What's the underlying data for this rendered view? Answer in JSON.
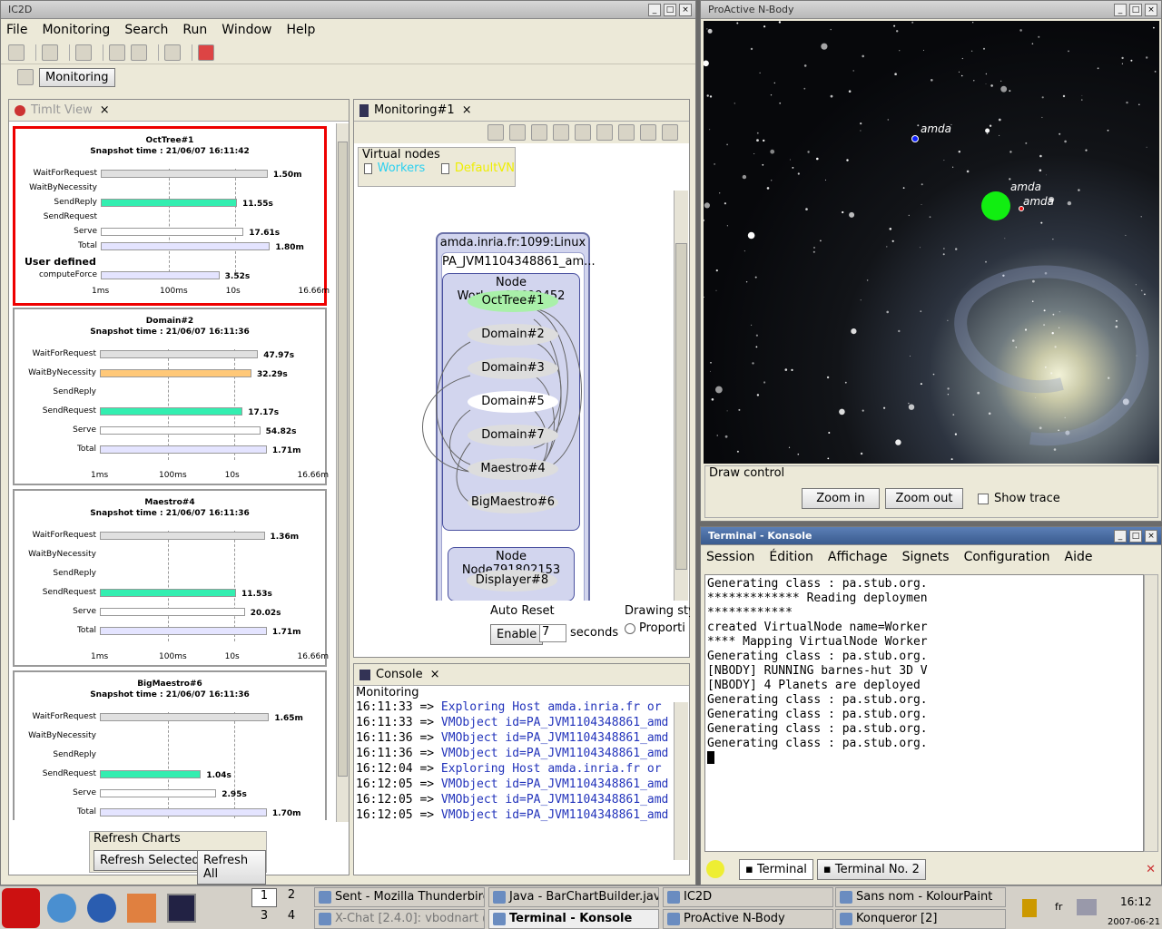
{
  "ic2d": {
    "title": "IC2D",
    "menu": [
      "File",
      "Monitoring",
      "Search",
      "Run",
      "Window",
      "Help"
    ],
    "perspective": "Monitoring",
    "timit": {
      "tab": "TimIt View",
      "axis": [
        "1ms",
        "100ms",
        "10s",
        "16.66m"
      ],
      "charts": [
        {
          "title": "OctTree#1",
          "snapshot": "Snapshot time : 21/06/07 16:11:42",
          "rows": [
            [
              "WaitForRequest",
              "1.50m",
              0.76,
              "#e0e0e0"
            ],
            [
              "WaitByNecessity",
              "",
              0,
              "#fff"
            ],
            [
              "SendReply",
              "11.55s",
              0.62,
              "#33eeb0"
            ],
            [
              "SendRequest",
              "",
              0,
              "#fff"
            ],
            [
              "Serve",
              "17.61s",
              0.65,
              "#fff"
            ],
            [
              "Total",
              "1.80m",
              0.77,
              "#e4e4ff"
            ]
          ],
          "user_defined": "User defined",
          "extra": [
            "computeForce",
            "3.52s",
            0.54
          ]
        },
        {
          "title": "Domain#2",
          "snapshot": "Snapshot time : 21/06/07 16:11:36",
          "rows": [
            [
              "WaitForRequest",
              "47.97s",
              0.72,
              "#e0e0e0"
            ],
            [
              "WaitByNecessity",
              "32.29s",
              0.69,
              "#ffc878"
            ],
            [
              "SendReply",
              "",
              0,
              "#fff"
            ],
            [
              "SendRequest",
              "17.17s",
              0.65,
              "#33eeb0"
            ],
            [
              "Serve",
              "54.82s",
              0.73,
              "#fff"
            ],
            [
              "Total",
              "1.71m",
              0.76,
              "#e4e4ff"
            ]
          ]
        },
        {
          "title": "Maestro#4",
          "snapshot": "Snapshot time : 21/06/07 16:11:36",
          "rows": [
            [
              "WaitForRequest",
              "1.36m",
              0.75,
              "#e0e0e0"
            ],
            [
              "WaitByNecessity",
              "",
              0,
              "#fff"
            ],
            [
              "SendReply",
              "",
              0,
              "#fff"
            ],
            [
              "SendRequest",
              "11.53s",
              0.62,
              "#33eeb0"
            ],
            [
              "Serve",
              "20.02s",
              0.66,
              "#fff"
            ],
            [
              "Total",
              "1.71m",
              0.76,
              "#e4e4ff"
            ]
          ]
        },
        {
          "title": "BigMaestro#6",
          "snapshot": "Snapshot time : 21/06/07 16:11:36",
          "rows": [
            [
              "WaitForRequest",
              "1.65m",
              0.77,
              "#e0e0e0"
            ],
            [
              "WaitByNecessity",
              "",
              0,
              "#fff"
            ],
            [
              "SendReply",
              "",
              0,
              "#fff"
            ],
            [
              "SendRequest",
              "1.04s",
              0.46,
              "#33eeb0"
            ],
            [
              "Serve",
              "2.95s",
              0.53,
              "#fff"
            ],
            [
              "Total",
              "1.70m",
              0.76,
              "#e4e4ff"
            ]
          ]
        }
      ],
      "refresh_group": "Refresh Charts",
      "refresh_selected": "Refresh Selected",
      "refresh_all": "Refresh All"
    },
    "monitoring": {
      "tab": "Monitoring#1",
      "virtual_nodes": "Virtual nodes",
      "vn_workers": "Workers",
      "vn_default": "DefaultVN",
      "host": "amda.inria.fr:1099:Linux",
      "jvm": "PA_JVM1104348861_am...",
      "node1": "Node Workers25699452",
      "objects": [
        "OctTree#1",
        "Domain#2",
        "Domain#3",
        "Domain#5",
        "Domain#7",
        "Maestro#4",
        "BigMaestro#6"
      ],
      "node2": "Node Node791802153",
      "displayer": "Displayer#8",
      "auto_reset": "Auto Reset",
      "enable": "Enable",
      "reset_value": "7",
      "seconds": "seconds",
      "drawing_style": "Drawing sty",
      "proportional": "Proporti"
    },
    "console": {
      "tab": "Console",
      "label": "Monitoring",
      "lines": [
        [
          "16:11:33 => ",
          "Exploring Host amda.inria.fr  or"
        ],
        [
          "16:11:33 => ",
          "VMObject id=PA_JVM1104348861_amd"
        ],
        [
          "16:11:36 => ",
          "VMObject id=PA_JVM1104348861_amd"
        ],
        [
          "16:11:36 => ",
          "VMObject id=PA_JVM1104348861_amd"
        ],
        [
          "16:12:04 => ",
          "Exploring Host amda.inria.fr  or"
        ],
        [
          "16:12:05 => ",
          "VMObject id=PA_JVM1104348861_amd"
        ],
        [
          "16:12:05 => ",
          "VMObject id=PA_JVM1104348861_amd"
        ],
        [
          "16:12:05 => ",
          "VMObject id=PA_JVM1104348861_amd"
        ]
      ]
    }
  },
  "nbody": {
    "title": "ProActive N-Body",
    "labels": [
      "amda",
      "amda",
      "amda"
    ],
    "draw_control": "Draw control",
    "zoom_in": "Zoom in",
    "zoom_out": "Zoom out",
    "show_trace": "Show trace"
  },
  "konsole": {
    "title": "Terminal - Konsole",
    "menu": [
      "Session",
      "Édition",
      "Affichage",
      "Signets",
      "Configuration",
      "Aide"
    ],
    "lines": [
      "Generating class : pa.stub.org.",
      "************* Reading deploymen",
      "************",
      "created VirtualNode name=Worker",
      "**** Mapping VirtualNode Worker",
      "Generating class : pa.stub.org.",
      "[NBODY] RUNNING barnes-hut 3D V",
      "[NBODY] 4 Planets are deployed",
      "Generating class : pa.stub.org.",
      "Generating class : pa.stub.org.",
      "Generating class : pa.stub.org.",
      "Generating class : pa.stub.org."
    ],
    "tabs": [
      "Terminal",
      "Terminal No. 2"
    ]
  },
  "taskbar": {
    "desktops": [
      "1",
      "2",
      "3",
      "4"
    ],
    "tasks": [
      "Sent - Mozilla Thunderbird",
      "Java - BarChartBuilder.java",
      "IC2D",
      "Sans nom - KolourPaint",
      "X-Chat [2.4.0]: vbodnart @",
      "Terminal - Konsole",
      "ProActive N-Body",
      "Konqueror [2]"
    ],
    "lang": "fr",
    "time": "16:12",
    "date": "2007-06-21"
  }
}
